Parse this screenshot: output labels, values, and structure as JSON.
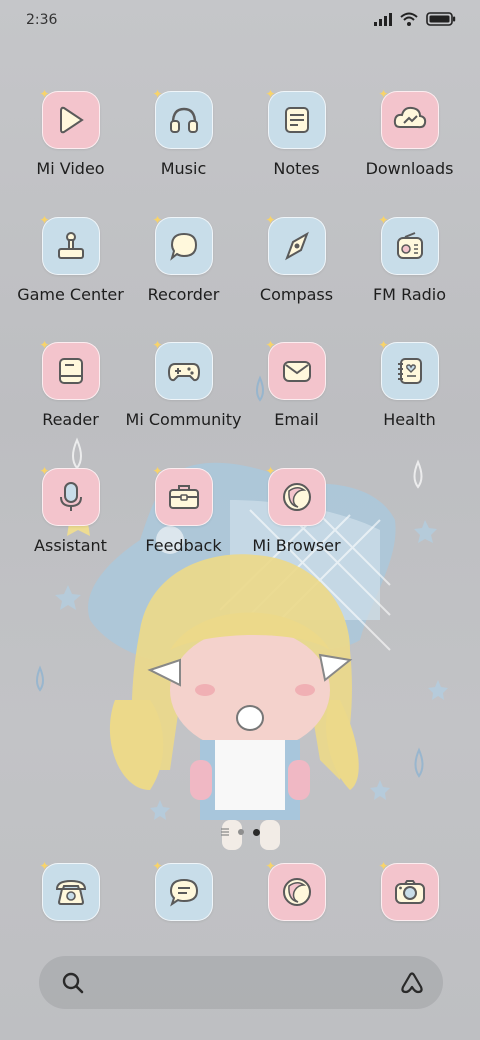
{
  "status_bar": {
    "time": "2:36",
    "icons": [
      "signal-icon",
      "wifi-icon",
      "battery-icon"
    ]
  },
  "apps": [
    {
      "label": "Mi Video",
      "icon": "play-icon",
      "tone": "pink"
    },
    {
      "label": "Music",
      "icon": "headphones-icon",
      "tone": "blue"
    },
    {
      "label": "Notes",
      "icon": "notepad-icon",
      "tone": "blue"
    },
    {
      "label": "Downloads",
      "icon": "cloud-download-icon",
      "tone": "pink"
    },
    {
      "label": "Game Center",
      "icon": "joystick-icon",
      "tone": "blue"
    },
    {
      "label": "Recorder",
      "icon": "speech-bubble-icon",
      "tone": "blue"
    },
    {
      "label": "Compass",
      "icon": "compass-icon",
      "tone": "blue"
    },
    {
      "label": "FM Radio",
      "icon": "radio-icon",
      "tone": "blue"
    },
    {
      "label": "Reader",
      "icon": "book-icon",
      "tone": "pink"
    },
    {
      "label": "Mi Community",
      "icon": "gamepad-icon",
      "tone": "blue"
    },
    {
      "label": "Email",
      "icon": "envelope-icon",
      "tone": "pink"
    },
    {
      "label": "Health",
      "icon": "heart-notebook-icon",
      "tone": "blue"
    },
    {
      "label": "Assistant",
      "icon": "microphone-icon",
      "tone": "pink"
    },
    {
      "label": "Feedback",
      "icon": "toolbox-icon",
      "tone": "pink"
    },
    {
      "label": "Mi Browser",
      "icon": "browser-globe-icon",
      "tone": "pink"
    }
  ],
  "page_indicator": {
    "pages": 2,
    "current": 2
  },
  "dock": [
    {
      "name": "phone",
      "icon": "telephone-icon",
      "tone": "blue"
    },
    {
      "name": "messages",
      "icon": "message-icon",
      "tone": "blue"
    },
    {
      "name": "browser",
      "icon": "browser-globe-icon",
      "tone": "pink"
    },
    {
      "name": "camera",
      "icon": "camera-icon",
      "tone": "pink"
    }
  ],
  "search_bar": {
    "left_icon": "search-icon",
    "right_icon": "assistant-a-icon"
  }
}
